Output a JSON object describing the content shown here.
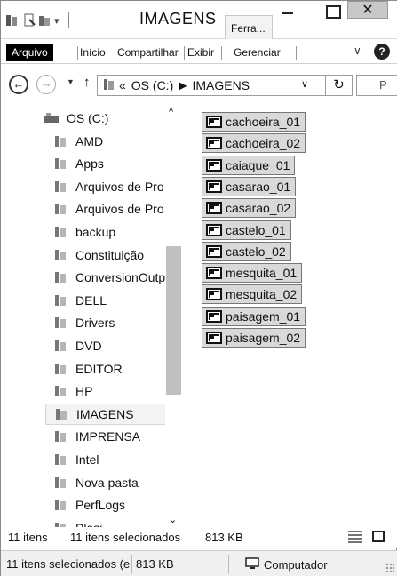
{
  "window": {
    "title": "IMAGENS",
    "contextual_tab": "Ferra..."
  },
  "ribbon": {
    "tabs": [
      "Arquivo",
      "Início",
      "Compartilhar",
      "Exibir",
      "Gerenciar"
    ]
  },
  "address": {
    "overflow": "«",
    "crumbs": [
      "OS (C:)",
      "IMAGENS"
    ],
    "search_placeholder": "P"
  },
  "nav": {
    "items": [
      {
        "label": "OS (C:)",
        "icon": "drive-icon"
      },
      {
        "label": "AMD",
        "icon": "folder-icon"
      },
      {
        "label": "Apps",
        "icon": "folder-icon"
      },
      {
        "label": "Arquivos de Pro",
        "icon": "folder-icon"
      },
      {
        "label": "Arquivos de Pro",
        "icon": "folder-icon"
      },
      {
        "label": "backup",
        "icon": "folder-icon"
      },
      {
        "label": "Constituição",
        "icon": "folder-icon"
      },
      {
        "label": "ConversionOutp",
        "icon": "folder-icon"
      },
      {
        "label": "DELL",
        "icon": "folder-icon"
      },
      {
        "label": "Drivers",
        "icon": "folder-icon"
      },
      {
        "label": "DVD",
        "icon": "folder-icon"
      },
      {
        "label": "EDITOR",
        "icon": "folder-icon"
      },
      {
        "label": "HP",
        "icon": "folder-icon"
      },
      {
        "label": "IMAGENS",
        "icon": "folder-icon",
        "selected": true
      },
      {
        "label": "IMPRENSA",
        "icon": "folder-icon"
      },
      {
        "label": "Intel",
        "icon": "folder-icon"
      },
      {
        "label": "Nova pasta",
        "icon": "folder-icon"
      },
      {
        "label": "PerfLogs",
        "icon": "folder-icon"
      },
      {
        "label": "Plasi...",
        "icon": "folder-icon"
      }
    ]
  },
  "files": [
    "cachoeira_01",
    "cachoeira_02",
    "caiaque_01",
    "casarao_01",
    "casarao_02",
    "castelo_01",
    "castelo_02",
    "mesquita_01",
    "mesquita_02",
    "paisagem_01",
    "paisagem_02"
  ],
  "status": {
    "item_count": "11 itens",
    "selected": "11 itens selecionados",
    "size": "813 KB"
  },
  "status_bar": {
    "selected": "11 itens selecionados (e:",
    "size": "813 KB",
    "location": "Computador"
  },
  "colors": {
    "selection_fill": "#d9d9d9",
    "file_tab_bg": "#000000",
    "close_button": "#c8c8c8"
  }
}
